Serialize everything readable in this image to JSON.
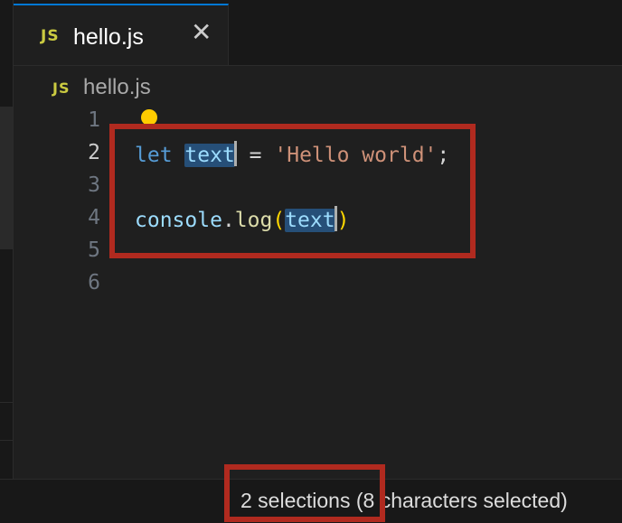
{
  "tab": {
    "badge": "JS",
    "label": "hello.js",
    "close_icon": "close-icon"
  },
  "breadcrumb": {
    "badge": "JS",
    "file": "hello.js"
  },
  "editor": {
    "line_numbers": [
      "1",
      "2",
      "3",
      "4",
      "5",
      "6"
    ],
    "active_line": "2",
    "code": {
      "line2": {
        "keyword": "let",
        "variable": "text",
        "operator": "=",
        "string": "'Hello world'",
        "semicolon": ";"
      },
      "line4": {
        "object": "console",
        "dot": ".",
        "method": "log",
        "open_paren": "(",
        "argument": "text",
        "close_paren": ")"
      }
    },
    "lightbulb_icon": "lightbulb-icon"
  },
  "status": {
    "selection_text": "2 selections (8 characters selected)"
  },
  "colors": {
    "accent": "#0078d4",
    "highlight_box": "#b02a1f",
    "selection": "#264f78",
    "lightbulb": "#ffcc00"
  }
}
